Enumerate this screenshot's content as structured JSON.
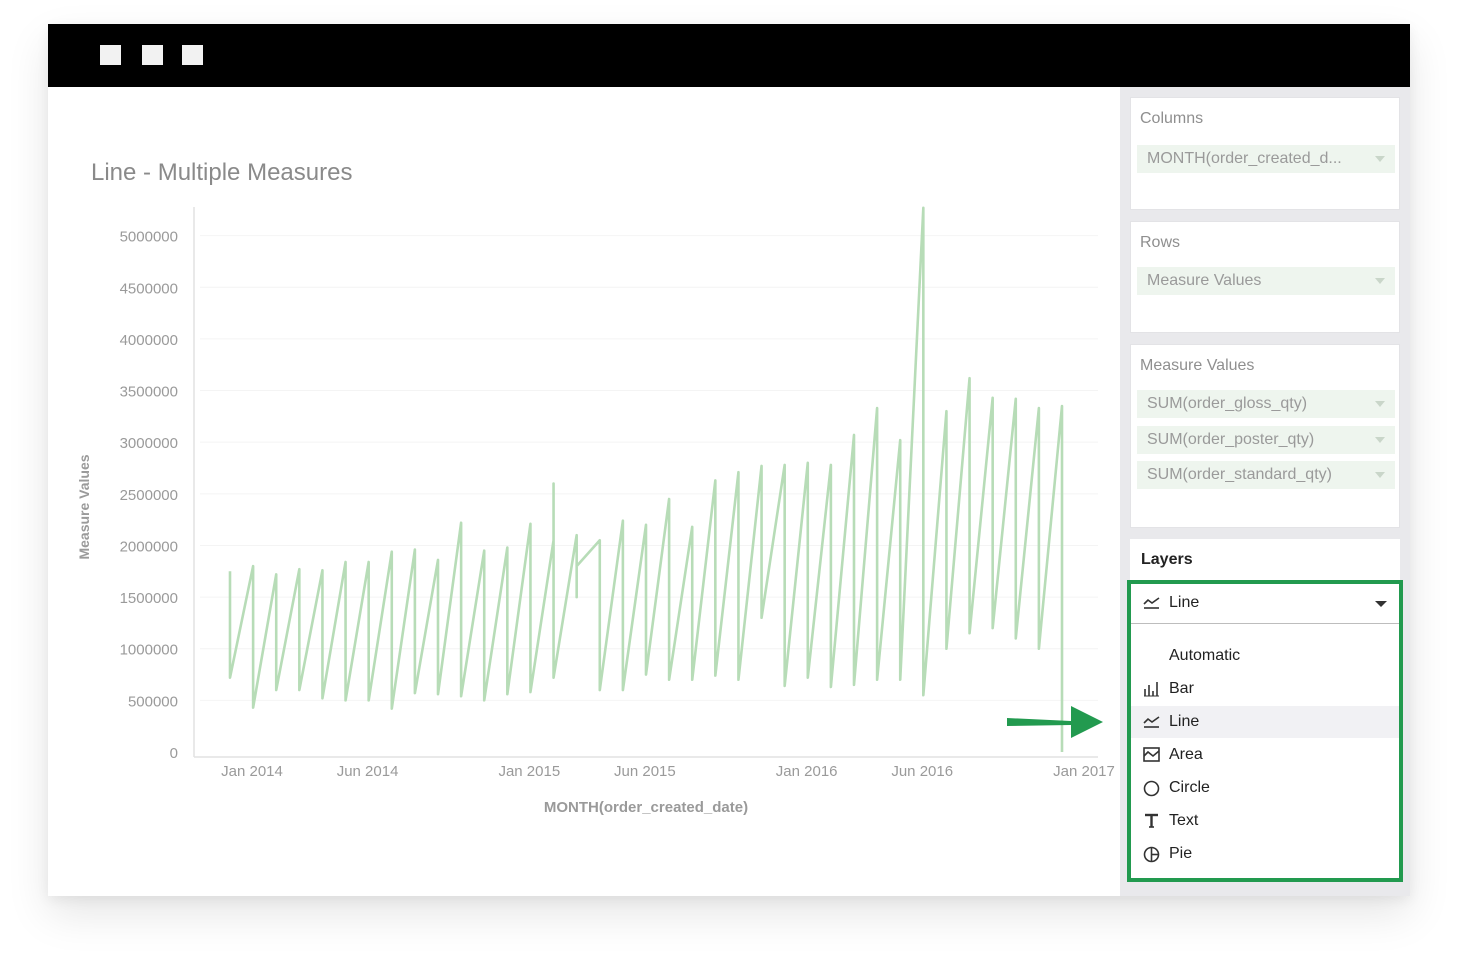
{
  "chart": {
    "title": "Line - Multiple Measures"
  },
  "chart_data": {
    "type": "line",
    "title": "Line - Multiple Measures",
    "xlabel": "MONTH(order_created_date)",
    "ylabel": "Measure Values",
    "ylim": [
      0,
      5500000
    ],
    "yticks": [
      0,
      500000,
      1000000,
      1500000,
      2000000,
      2500000,
      3000000,
      3500000,
      4000000,
      4500000,
      5000000
    ],
    "xticks": [
      "Jan 2014",
      "Jun 2014",
      "Jan 2015",
      "Jun 2015",
      "Jan 2016",
      "Jun 2016",
      "Jan 2017"
    ],
    "x": [
      "2014-01",
      "2014-02",
      "2014-03",
      "2014-04",
      "2014-05",
      "2014-06",
      "2014-07",
      "2014-08",
      "2014-09",
      "2014-10",
      "2014-11",
      "2014-12",
      "2015-01",
      "2015-02",
      "2015-03",
      "2015-04",
      "2015-05",
      "2015-06",
      "2015-07",
      "2015-08",
      "2015-09",
      "2015-10",
      "2015-11",
      "2015-12",
      "2016-01",
      "2016-02",
      "2016-03",
      "2016-04",
      "2016-05",
      "2016-06",
      "2016-07",
      "2016-08",
      "2016-09",
      "2016-10",
      "2016-11",
      "2016-12",
      "2017-01"
    ],
    "series": [
      {
        "values": [
          1750000,
          1800000,
          1720000,
          1770000,
          1760000,
          1840000,
          1840000,
          1940000,
          1960000,
          1860000,
          2220000,
          1950000,
          1980000,
          2210000,
          2050000,
          2100000,
          2050000,
          2240000,
          2200000,
          2450000,
          2180000,
          2630000,
          2710000,
          2770000,
          2780000,
          2800000,
          2780000,
          3070000,
          3330000,
          3020000,
          5270000,
          3300000,
          3620000,
          3430000,
          3420000,
          3330000,
          3350000
        ]
      },
      {
        "values": [
          720000,
          800000,
          700000,
          750000,
          1000000,
          700000,
          700000,
          1000000,
          1000000,
          700000,
          1100000,
          700000,
          900000,
          700000,
          2600000,
          1500000,
          800000,
          1300000,
          1200000,
          1300000,
          1600000,
          1400000,
          1300000,
          1300000,
          1200000,
          1000000,
          1400000,
          1700000,
          1300000,
          1800000,
          2450000,
          1900000,
          1600000,
          1800000,
          1700000,
          1600000,
          1400000
        ]
      },
      {
        "values": [
          720000,
          430000,
          600000,
          600000,
          520000,
          500000,
          500000,
          420000,
          570000,
          560000,
          540000,
          500000,
          560000,
          580000,
          720000,
          1800000,
          600000,
          600000,
          750000,
          700000,
          700000,
          740000,
          700000,
          1300000,
          640000,
          720000,
          630000,
          650000,
          700000,
          700000,
          550000,
          1000000,
          1150000,
          1200000,
          1100000,
          1000000,
          0
        ]
      }
    ],
    "colors": [
      "#b7dcb7"
    ],
    "grid": true,
    "legend": "none"
  },
  "window": {
    "button_count": 3
  },
  "sidebar": {
    "columns": {
      "title": "Columns",
      "pills": [
        "MONTH(order_created_d..."
      ]
    },
    "rows": {
      "title": "Rows",
      "pills": [
        "Measure Values"
      ]
    },
    "measure_values": {
      "title": "Measure Values",
      "pills": [
        "SUM(order_gloss_qty)",
        "SUM(order_poster_qty)",
        "SUM(order_standard_qty)"
      ]
    },
    "layers": {
      "title": "Layers",
      "selected": "Line",
      "selected_icon": "line-chart-icon",
      "options": [
        {
          "label": "Automatic",
          "icon": "none"
        },
        {
          "label": "Bar",
          "icon": "bar-chart-icon"
        },
        {
          "label": "Line",
          "icon": "line-chart-icon"
        },
        {
          "label": "Area",
          "icon": "area-chart-icon"
        },
        {
          "label": "Circle",
          "icon": "circle-icon"
        },
        {
          "label": "Text",
          "icon": "text-icon"
        },
        {
          "label": "Pie",
          "icon": "pie-chart-icon"
        }
      ]
    }
  },
  "colors": {
    "highlight": "#229a4f",
    "line": "#b7dcb7",
    "pill": "#eef5ee",
    "titlebar": "#000000"
  }
}
